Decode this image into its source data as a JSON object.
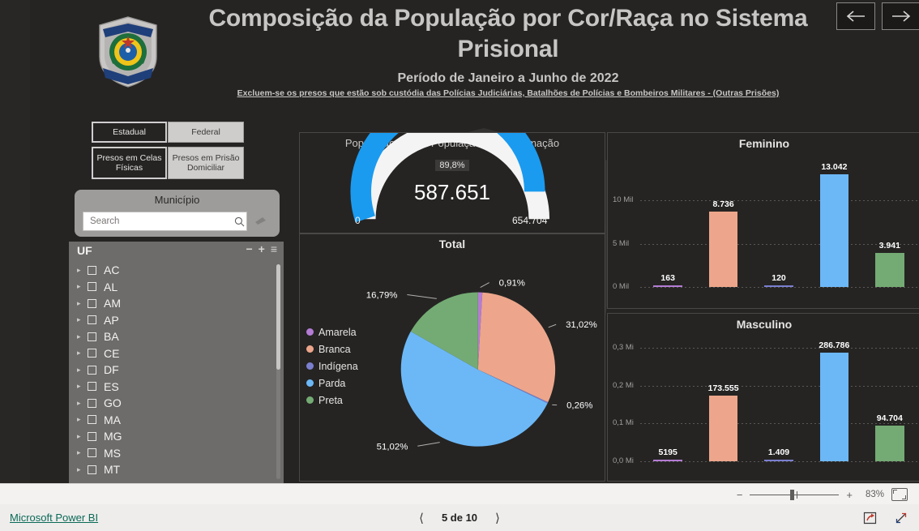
{
  "header": {
    "title": "Composição da População por Cor/Raça no Sistema Prisional",
    "subtitle": "Período de Janeiro a Junho de 2022",
    "disclaimer": "Excluem-se os presos que estão sob custódia das Polícias Judiciárias, Batalhões de Polícias e Bombeiros Militares - (Outras Prisões)",
    "logo_alt": "Departamento Penitenciário Nacional",
    "nav_prev": "previous-page-arrow",
    "nav_next": "next-page-arrow"
  },
  "slicers": {
    "scope": {
      "options": [
        "Estadual",
        "Federal"
      ],
      "selected": "Estadual"
    },
    "custody": {
      "options": [
        "Presos em Celas Físicas",
        "Presos em Prisão Domiciliar"
      ],
      "selected": "Presos em Celas Físicas"
    },
    "municipio": {
      "title": "Município",
      "search_placeholder": "Search",
      "search_value": "",
      "search_icon": "search-icon",
      "clear_icon": "eraser-icon"
    },
    "uf": {
      "title": "UF",
      "icons": [
        "collapse-all-icon",
        "expand-all-icon",
        "filter-menu-icon"
      ],
      "items": [
        "AC",
        "AL",
        "AM",
        "AP",
        "BA",
        "CE",
        "DF",
        "ES",
        "GO",
        "MA",
        "MG",
        "MS",
        "MT"
      ]
    }
  },
  "colors": {
    "amarela": "#b47cd4",
    "branca": "#eda68b",
    "indigena": "#7b7fd0",
    "parda": "#6cb8f7",
    "preta": "#74ab74",
    "gauge_fill": "#1a9bf0",
    "gauge_rest": "#f4f4f4",
    "canvas_bg": "#252423",
    "link": "#0b6a57"
  },
  "chart_data": [
    {
      "type": "gauge",
      "title": "População Total x População com Informação",
      "value": 587651,
      "value_label": "587.651",
      "percent_label": "89,8%",
      "min": 0,
      "min_label": "0",
      "max": 654704,
      "max_label": "654.704"
    },
    {
      "type": "pie",
      "title": "Total",
      "categories": [
        "Amarela",
        "Branca",
        "Indígena",
        "Parda",
        "Preta"
      ],
      "values": [
        0.91,
        31.02,
        0.26,
        51.02,
        16.79
      ],
      "labels": [
        "0,91%",
        "31,02%",
        "0,26%",
        "51,02%",
        "16,79%"
      ],
      "legend_position": "left",
      "unit": "%"
    },
    {
      "type": "bar",
      "title": "Feminino",
      "categories": [
        "Amarela",
        "Branca",
        "Indígena",
        "Parda",
        "Preta"
      ],
      "values": [
        163,
        8736,
        120,
        13042,
        3941
      ],
      "labels": [
        "163",
        "8.736",
        "120",
        "13.042",
        "3.941"
      ],
      "ylabel": "",
      "ytick_labels": [
        "0 Mil",
        "5 Mil",
        "10 Mil"
      ],
      "ytick_values": [
        0,
        5000,
        10000
      ],
      "ylim": [
        0,
        15000
      ],
      "grid": true
    },
    {
      "type": "bar",
      "title": "Masculino",
      "categories": [
        "Amarela",
        "Branca",
        "Indígena",
        "Parda",
        "Preta"
      ],
      "values": [
        5195,
        173555,
        1409,
        286786,
        94704
      ],
      "labels": [
        "5195",
        "173.555",
        "1.409",
        "286.786",
        "94.704"
      ],
      "ylabel": "",
      "ytick_labels": [
        "0,0 Mi",
        "0,1 Mi",
        "0,2 Mi",
        "0,3 Mi"
      ],
      "ytick_values": [
        0,
        100000,
        200000,
        300000
      ],
      "ylim": [
        0,
        330000
      ],
      "grid": true
    }
  ],
  "zoombar": {
    "minus": "−",
    "plus": "+",
    "percent": "83%",
    "fit_icon": "fit-to-page-icon"
  },
  "footer": {
    "brand": "Microsoft Power BI",
    "prev_icon": "chevron-left-icon",
    "next_icon": "chevron-right-icon",
    "page_text": "5 de 10",
    "share_icon": "share-icon",
    "fullscreen_icon": "fullscreen-icon"
  }
}
